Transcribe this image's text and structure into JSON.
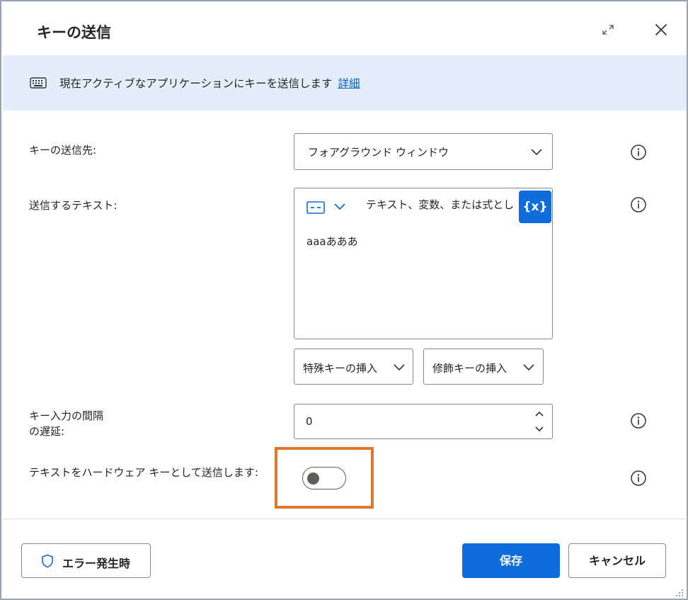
{
  "dialog": {
    "title": "キーの送信"
  },
  "infobar": {
    "icon": "keyboard-icon",
    "text": "現在アクティブなアプリケーションにキーを送信します",
    "link": "詳細"
  },
  "fields": {
    "target": {
      "label": "キーの送信先:",
      "value": "フォアグラウンド ウィンドウ"
    },
    "text": {
      "label": "送信するテキスト:",
      "placeholder": "テキスト、変数、または式とし",
      "var_button": "{x}",
      "value": "aaaあああ",
      "insert_special": "特殊キーの挿入",
      "insert_modifier": "修飾キーの挿入"
    },
    "delay": {
      "label_line1": "キー入力の間隔",
      "label_line2": "の遅延:",
      "value": "0"
    },
    "hardware": {
      "label": "テキストをハードウェア キーとして送信します:",
      "toggle_on": false
    }
  },
  "footer": {
    "error_button": "エラー発生時",
    "save_button": "保存",
    "cancel_button": "キャンセル"
  },
  "colors": {
    "accent": "#0f6cdd",
    "infobar_bg": "#e4eefa",
    "highlight": "#e0772e",
    "link": "#0f5fc7"
  }
}
